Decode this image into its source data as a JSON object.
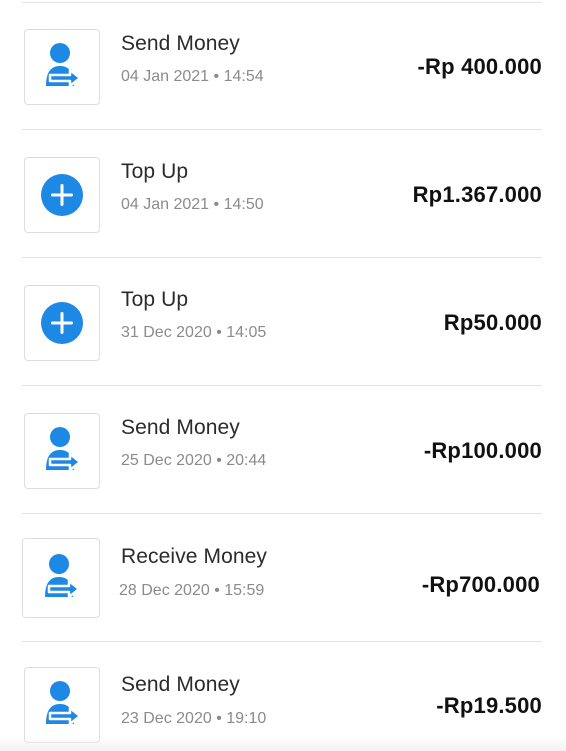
{
  "colors": {
    "accent": "#1e88e5",
    "amount": "#111111",
    "subtitle": "#8b8b8b",
    "divider": "#e3e3e3"
  },
  "transactions": [
    {
      "title": "Send Money",
      "date": "04 Jan 2021",
      "time": "14:54",
      "separator": "•",
      "amount": "-Rp 400.000",
      "icon": "send-money-icon"
    },
    {
      "title": "Top Up",
      "date": "04 Jan 2021",
      "time": "14:50",
      "separator": "•",
      "amount": "Rp1.367.000",
      "icon": "top-up-icon"
    },
    {
      "title": "Top Up",
      "date": "31 Dec 2020",
      "time": "14:05",
      "separator": "•",
      "amount": "Rp50.000",
      "icon": "top-up-icon"
    },
    {
      "title": "Send Money",
      "date": "25 Dec 2020",
      "time": "20:44",
      "separator": "•",
      "amount": "-Rp100.000",
      "icon": "send-money-icon"
    },
    {
      "title": "Receive Money",
      "date": "28 Dec 2020",
      "time": "15:59",
      "separator": "•",
      "amount": "-Rp700.000",
      "icon": "send-money-icon"
    },
    {
      "title": "Send Money",
      "date": "23 Dec 2020",
      "time": "19:10",
      "separator": "•",
      "amount": "-Rp19.500",
      "icon": "send-money-icon"
    }
  ]
}
